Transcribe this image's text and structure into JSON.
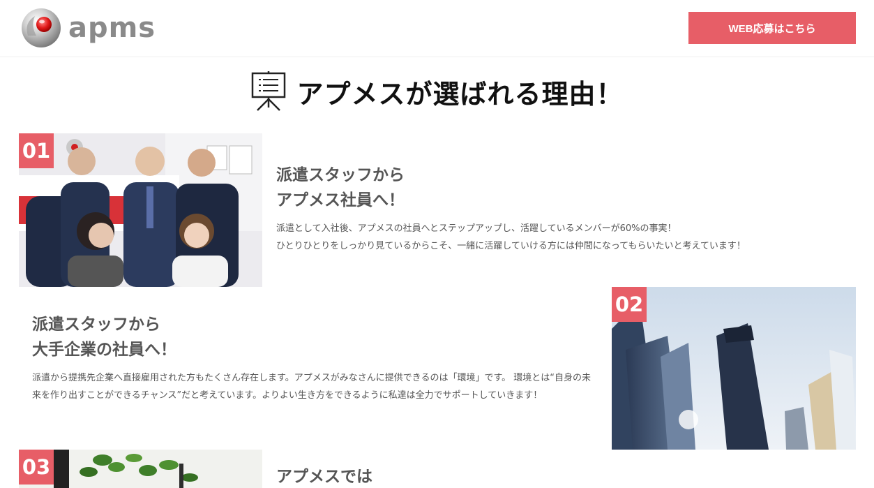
{
  "header": {
    "logo_text": "apms",
    "apply_button": "WEB応募はこちら",
    "accent_color": "#e75e67"
  },
  "section": {
    "title": "アプメスが選ばれる理由！",
    "icon": "presentation-board-icon"
  },
  "reasons": [
    {
      "number": "01",
      "heading_line1": "派遣スタッフから",
      "heading_line2": "アプメス社員へ！",
      "body_line1": "派遣として入社後、アプメスの社員へとステップアップし、活躍しているメンバーが60%の事実！",
      "body_line2": "ひとりひとりをしっかり見ているからこそ、一緒に活躍していける方には仲間になってもらいたいと考えています！",
      "photo": "staff-group-photo"
    },
    {
      "number": "02",
      "heading_line1": "派遣スタッフから",
      "heading_line2": "大手企業の社員へ！",
      "body": "派遣から提携先企業へ直接雇用された方もたくさん存在します。アプメスがみなさんに提供できるのは「環境」です。 環境とは“自身の未来を作り出すことができるチャンス”だと考えています。よりよい生き方をできるように私達は全力でサポートしていきます！",
      "photo": "office-buildings-photo"
    },
    {
      "number": "03",
      "heading_line1": "アプメスでは",
      "photo": "office-plants-photo"
    }
  ]
}
